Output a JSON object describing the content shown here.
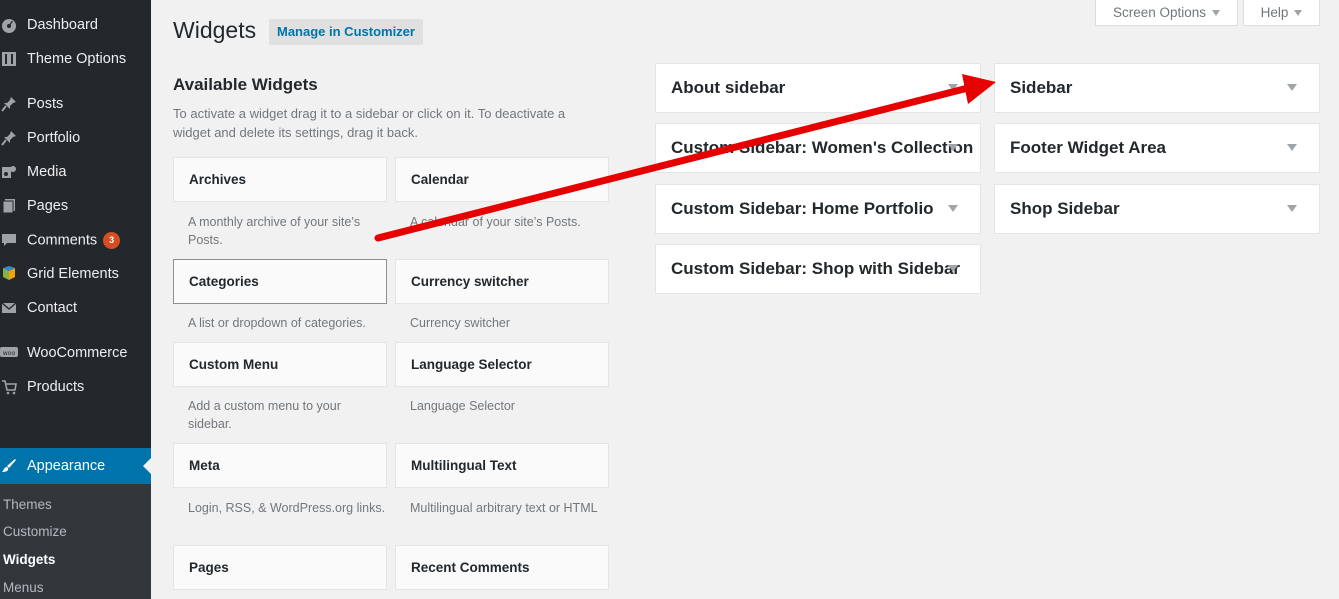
{
  "admin_menu": {
    "items": [
      {
        "label": "Dashboard",
        "icon": "dashboard-icon"
      },
      {
        "label": "Theme Options",
        "icon": "theme-options-icon"
      },
      {
        "label": "Posts",
        "icon": "pin-icon"
      },
      {
        "label": "Portfolio",
        "icon": "pin-icon"
      },
      {
        "label": "Media",
        "icon": "media-icon"
      },
      {
        "label": "Pages",
        "icon": "pages-icon"
      },
      {
        "label": "Comments",
        "icon": "comment-icon",
        "badge": "3"
      },
      {
        "label": "Grid Elements",
        "icon": "grid-elements-icon"
      },
      {
        "label": "Contact",
        "icon": "mail-icon"
      },
      {
        "label": "WooCommerce",
        "icon": "woocommerce-icon"
      },
      {
        "label": "Products",
        "icon": "cart-icon"
      },
      {
        "label": "Appearance",
        "icon": "paintbrush-icon"
      }
    ],
    "submenu": [
      "Themes",
      "Customize",
      "Widgets",
      "Menus"
    ]
  },
  "header": {
    "title": "Widgets",
    "customizer_button": "Manage in Customizer",
    "screen_options": "Screen Options",
    "help": "Help"
  },
  "available": {
    "title": "Available Widgets",
    "description": "To activate a widget drag it to a sidebar or click on it. To deactivate a widget and delete its settings, drag it back.",
    "widgets": [
      {
        "name": "Archives",
        "desc": "A monthly archive of your site’s Posts."
      },
      {
        "name": "Calendar",
        "desc": "A calendar of your site’s Posts."
      },
      {
        "name": "Categories",
        "desc": "A list or dropdown of categories."
      },
      {
        "name": "Currency switcher",
        "desc": "Currency switcher"
      },
      {
        "name": "Custom Menu",
        "desc": "Add a custom menu to your sidebar."
      },
      {
        "name": "Language Selector",
        "desc": "Language Selector"
      },
      {
        "name": "Meta",
        "desc": "Login, RSS, & WordPress.org links."
      },
      {
        "name": "Multilingual Text",
        "desc": "Multilingual arbitrary text or HTML"
      },
      {
        "name": "Pages",
        "desc": ""
      },
      {
        "name": "Recent Comments",
        "desc": ""
      }
    ]
  },
  "sidebars": {
    "left": [
      "About sidebar",
      "Custom Sidebar: Women's Collection",
      "Custom Sidebar: Home Portfolio",
      "Custom Sidebar: Shop with Sidebar"
    ],
    "right": [
      "Sidebar",
      "Footer Widget Area",
      "Shop Sidebar"
    ]
  },
  "colors": {
    "admin_bg": "#23282d",
    "accent": "#0073aa",
    "badge": "#d54e21",
    "arrow": "#ff0000"
  }
}
